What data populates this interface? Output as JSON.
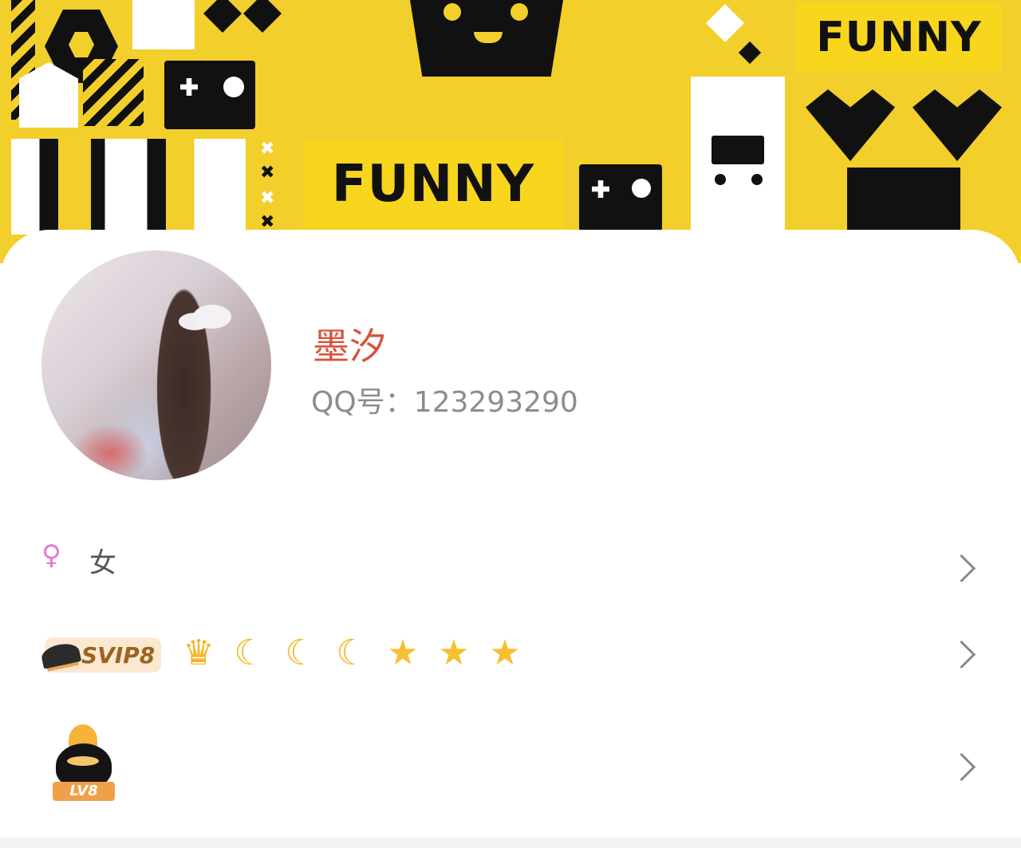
{
  "banner": {
    "tag_text_1": "FUNNY",
    "tag_text_2": "FUNNY",
    "background_color": "#f2cf2b"
  },
  "profile": {
    "nickname": "墨汐",
    "qq_label": "QQ号：",
    "qq_number": "123293290",
    "nickname_color": "#d8533c"
  },
  "rows": {
    "gender": {
      "icon": "female-icon",
      "icon_glyph": "♀",
      "label": "女"
    },
    "vip": {
      "badge_label": "SVIP8",
      "level_icons": [
        {
          "name": "crown-icon",
          "glyph": "♛"
        },
        {
          "name": "moon-icon",
          "glyph": "☾"
        },
        {
          "name": "moon-icon",
          "glyph": "☾"
        },
        {
          "name": "moon-icon",
          "glyph": "☾"
        },
        {
          "name": "star-icon",
          "glyph": "★"
        },
        {
          "name": "star-icon",
          "glyph": "★"
        },
        {
          "name": "star-icon",
          "glyph": "★"
        }
      ]
    },
    "level": {
      "badge_label": "LV8"
    }
  }
}
